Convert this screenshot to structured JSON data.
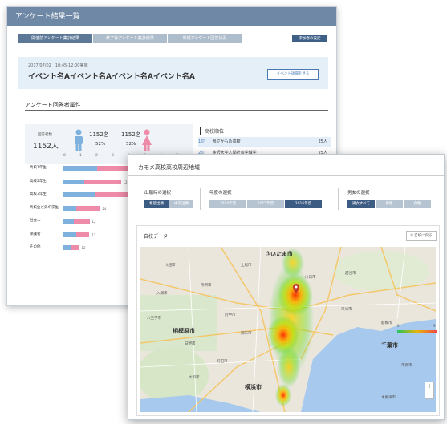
{
  "survey_window": {
    "title": "アンケート結果一覧",
    "tabs": [
      "開催前アンケート集計結果",
      "終了後アンケート集計結果",
      "新規アンケート回答状況"
    ],
    "tab_right": "参加者の設定",
    "event_date": "2017/07/02　10:45-12:00実施",
    "event_name": "イベント名Aイベント名Aイベント名Aイベント名A",
    "event_button": "イベント詳細を見る",
    "section_title": "アンケート回答者属性",
    "stats": {
      "total_label": "回答者数",
      "total_value": "1152人",
      "male_value": "1152名",
      "male_pct": "52%",
      "female_value": "1152名",
      "female_pct": "52%"
    },
    "axis_ticks": [
      "0",
      "1",
      "2",
      "3",
      "4",
      "5",
      "6",
      "7"
    ],
    "rows": [
      {
        "label": "高校1年生",
        "blue": 0.32,
        "pink": 0.68,
        "value": ""
      },
      {
        "label": "高校2年生",
        "blue": 0.2,
        "pink": 0.55,
        "value": "12"
      },
      {
        "label": "高校3年生",
        "blue": 0.3,
        "pink": 1.0,
        "value": ""
      },
      {
        "label": "高校生以外の学生",
        "blue": 0.12,
        "pink": 0.35,
        "value": "24"
      },
      {
        "label": "社会人",
        "blue": 0.1,
        "pink": 0.25,
        "value": "12"
      },
      {
        "label": "保護者",
        "blue": 0.12,
        "pink": 0.25,
        "value": "12"
      },
      {
        "label": "その他",
        "blue": 0.08,
        "pink": 0.15,
        "value": "12"
      }
    ],
    "ranking_title": "高校順位",
    "ranking": [
      {
        "rank": "1位",
        "name": "県立かもめ高校",
        "count": "25人"
      },
      {
        "rank": "2位",
        "name": "金沢大学人間社会学域学",
        "count": "25人"
      }
    ]
  },
  "map_window": {
    "title": "カモメ高校高校周辺地域",
    "group1": {
      "label": "出願時の選択",
      "options": [
        "希望出願",
        "中学出願"
      ],
      "selected": 0
    },
    "group2": {
      "label": "年度の選択",
      "options": [
        "2014年度",
        "2015年度",
        "2016年度"
      ],
      "selected": 2
    },
    "group3": {
      "label": "男女の選択",
      "options": [
        "男女すべて",
        "男性",
        "女性"
      ],
      "selected": 0
    },
    "card_title": "自校データ",
    "card_button": "自校に戻る",
    "map_cities": [
      {
        "name": "さいたま市"
      },
      {
        "name": "千葉市"
      },
      {
        "name": "相模原市"
      },
      {
        "name": "横浜市"
      }
    ],
    "map_labels": [
      "川越市",
      "所沢市",
      "八王子市",
      "町田市",
      "府中市",
      "調布市",
      "船橋市",
      "市川市",
      "川口市",
      "越谷市",
      "木更津市",
      "大和市",
      "日野市",
      "市原市",
      "入間市",
      "上尾市"
    ],
    "zoom": [
      "+",
      "−"
    ],
    "legend_min": "0",
    "legend_max": "9"
  },
  "colors": {
    "header": "#6f88a6",
    "tab_active": "#5d7896",
    "male_blue": "#7fb1de",
    "female_pink": "#ee8ba8",
    "segment_active": "#3d5c84"
  }
}
